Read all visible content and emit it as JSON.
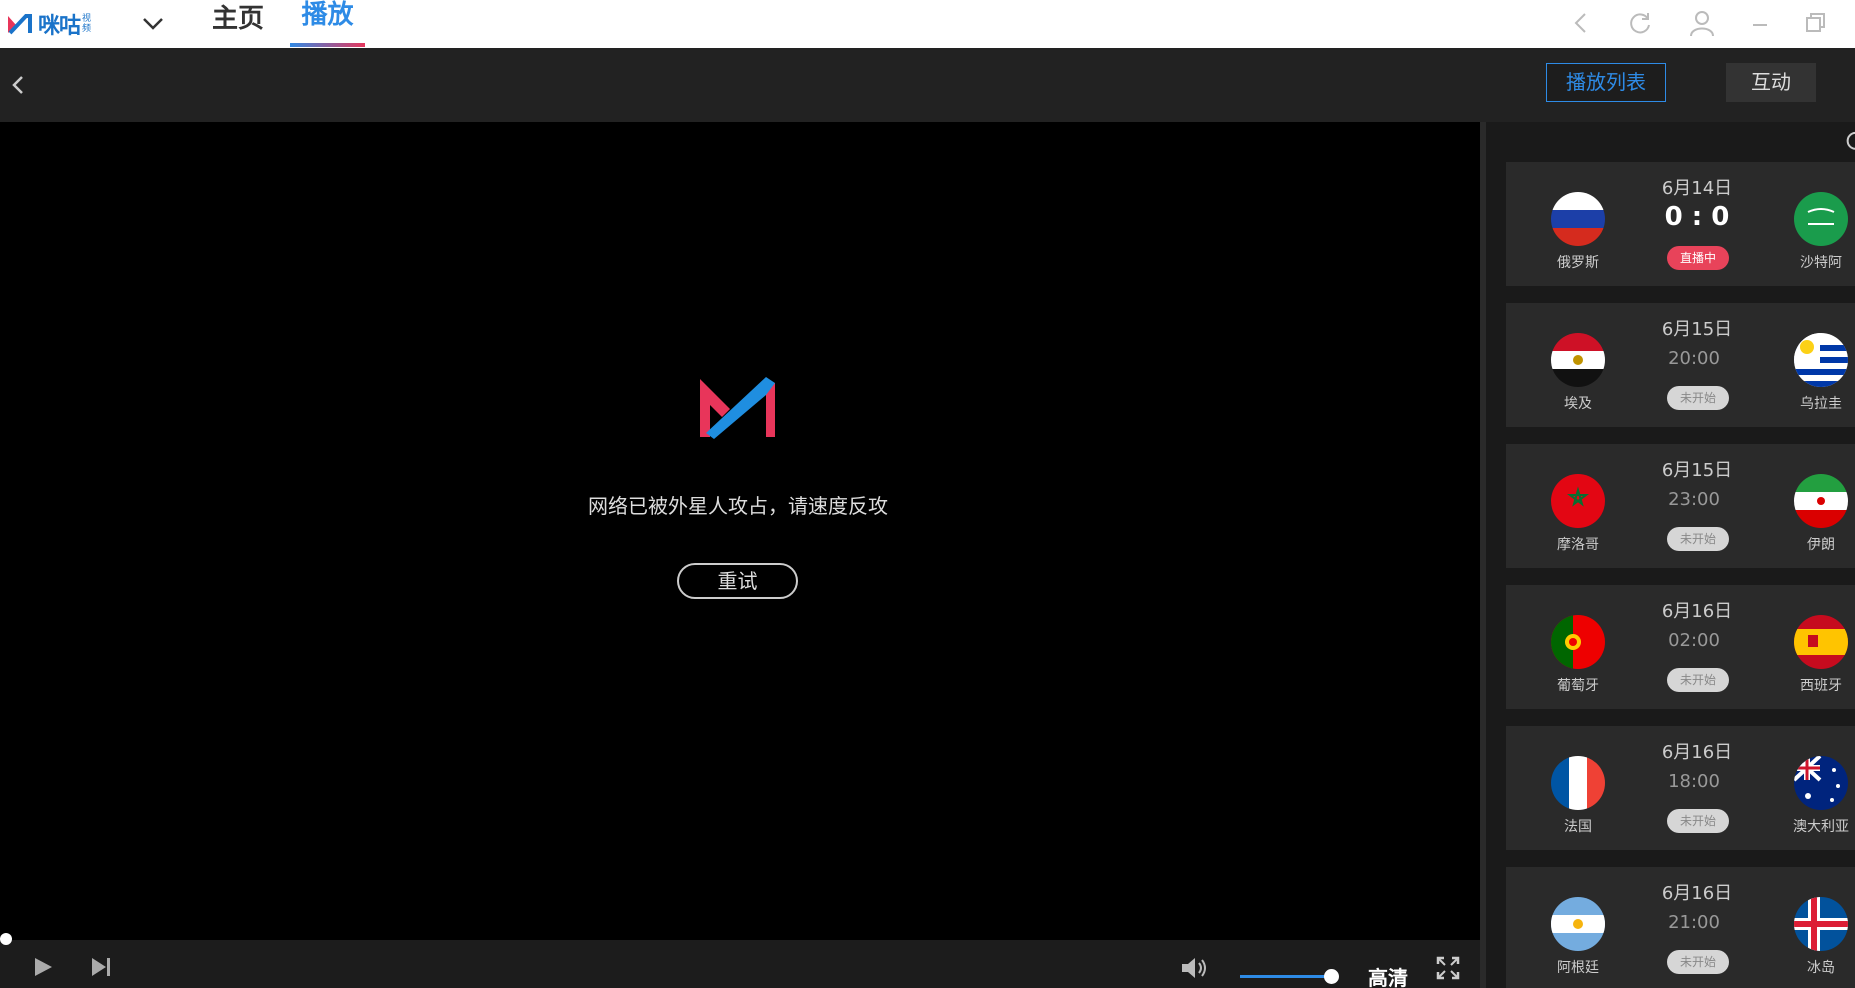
{
  "app": {
    "logo_text": "咪咕",
    "logo_sub": "视频"
  },
  "nav": {
    "home": "主页",
    "play": "播放"
  },
  "subbar": {
    "playlist": "播放列表",
    "interact": "互动"
  },
  "player": {
    "error_message": "网络已被外星人攻占，请速度反攻",
    "retry": "重试",
    "quality": "高清",
    "volume": 0.9,
    "progress": 0
  },
  "matches": [
    {
      "date": "6月14日",
      "score": "0 : 0",
      "status": "直播中",
      "live": true,
      "home": "俄罗斯",
      "away": "沙特阿",
      "home_flag": "russia",
      "away_flag": "saudi"
    },
    {
      "date": "6月15日",
      "time": "20:00",
      "status": "未开始",
      "live": false,
      "home": "埃及",
      "away": "乌拉圭",
      "home_flag": "egypt",
      "away_flag": "uruguay"
    },
    {
      "date": "6月15日",
      "time": "23:00",
      "status": "未开始",
      "live": false,
      "home": "摩洛哥",
      "away": "伊朗",
      "home_flag": "morocco",
      "away_flag": "iran"
    },
    {
      "date": "6月16日",
      "time": "02:00",
      "status": "未开始",
      "live": false,
      "home": "葡萄牙",
      "away": "西班牙",
      "home_flag": "portugal",
      "away_flag": "spain"
    },
    {
      "date": "6月16日",
      "time": "18:00",
      "status": "未开始",
      "live": false,
      "home": "法国",
      "away": "澳大利亚",
      "home_flag": "france",
      "away_flag": "australia"
    },
    {
      "date": "6月16日",
      "time": "21:00",
      "status": "未开始",
      "live": false,
      "home": "阿根廷",
      "away": "冰岛",
      "home_flag": "argentina",
      "away_flag": "iceland"
    }
  ],
  "colors": {
    "accent": "#2e8be6",
    "live": "#e8435a",
    "brand_red": "#e8355a"
  }
}
